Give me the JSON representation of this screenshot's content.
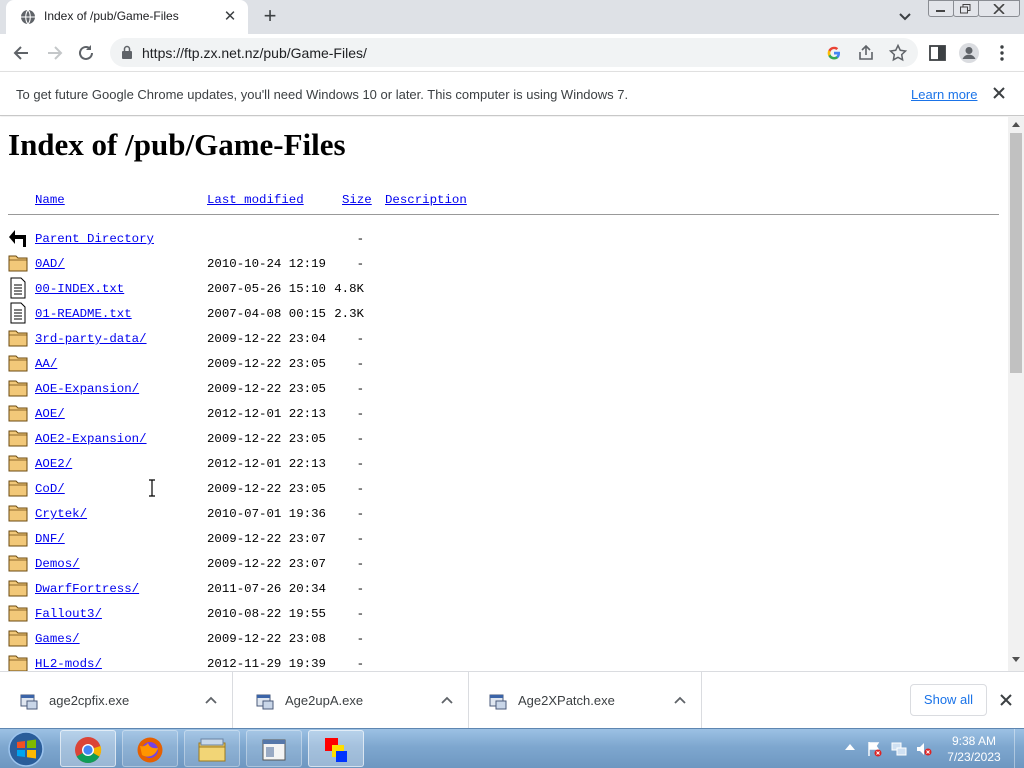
{
  "browser": {
    "tab": {
      "title": "Index of /pub/Game-Files",
      "favicon": "globe-icon"
    },
    "url": "https://ftp.zx.net.nz/pub/Game-Files/",
    "infobar": {
      "message": "To get future Google Chrome updates, you'll need Windows 10 or later. This computer is using Windows 7.",
      "link": "Learn more"
    }
  },
  "page": {
    "heading": "Index of /pub/Game-Files",
    "columns": {
      "name": "Name",
      "modified": "Last modified",
      "size": "Size",
      "description": "Description"
    },
    "rows": [
      {
        "icon": "back-icon",
        "name": "Parent Directory",
        "modified": "",
        "size": "-"
      },
      {
        "icon": "folder-icon",
        "name": "0AD/",
        "modified": "2010-10-24 12:19",
        "size": "-"
      },
      {
        "icon": "text-file-icon",
        "name": "00-INDEX.txt",
        "modified": "2007-05-26 15:10",
        "size": "4.8K"
      },
      {
        "icon": "text-file-icon",
        "name": "01-README.txt",
        "modified": "2007-04-08 00:15",
        "size": "2.3K"
      },
      {
        "icon": "folder-icon",
        "name": "3rd-party-data/",
        "modified": "2009-12-22 23:04",
        "size": "-"
      },
      {
        "icon": "folder-icon",
        "name": "AA/",
        "modified": "2009-12-22 23:05",
        "size": "-"
      },
      {
        "icon": "folder-icon",
        "name": "AOE-Expansion/",
        "modified": "2009-12-22 23:05",
        "size": "-"
      },
      {
        "icon": "folder-icon",
        "name": "AOE/",
        "modified": "2012-12-01 22:13",
        "size": "-"
      },
      {
        "icon": "folder-icon",
        "name": "AOE2-Expansion/",
        "modified": "2009-12-22 23:05",
        "size": "-"
      },
      {
        "icon": "folder-icon",
        "name": "AOE2/",
        "modified": "2012-12-01 22:13",
        "size": "-"
      },
      {
        "icon": "folder-icon",
        "name": "CoD/",
        "modified": "2009-12-22 23:05",
        "size": "-"
      },
      {
        "icon": "folder-icon",
        "name": "Crytek/",
        "modified": "2010-07-01 19:36",
        "size": "-"
      },
      {
        "icon": "folder-icon",
        "name": "DNF/",
        "modified": "2009-12-22 23:07",
        "size": "-"
      },
      {
        "icon": "folder-icon",
        "name": "Demos/",
        "modified": "2009-12-22 23:07",
        "size": "-"
      },
      {
        "icon": "folder-icon",
        "name": "DwarfFortress/",
        "modified": "2011-07-26 20:34",
        "size": "-"
      },
      {
        "icon": "folder-icon",
        "name": "Fallout3/",
        "modified": "2010-08-22 19:55",
        "size": "-"
      },
      {
        "icon": "folder-icon",
        "name": "Games/",
        "modified": "2009-12-22 23:08",
        "size": "-"
      },
      {
        "icon": "folder-icon",
        "name": "HL2-mods/",
        "modified": "2012-11-29 19:39",
        "size": "-"
      }
    ]
  },
  "downloads": {
    "items": [
      {
        "name": "age2cpfix.exe",
        "icon": "exe-icon"
      },
      {
        "name": "Age2upA.exe",
        "icon": "exe-icon"
      },
      {
        "name": "Age2XPatch.exe",
        "icon": "exe-icon"
      }
    ],
    "show_all": "Show all"
  },
  "taskbar": {
    "apps": [
      "chrome-icon",
      "firefox-icon",
      "file-explorer-icon",
      "window-app-icon",
      "paint-app-icon"
    ],
    "time": "9:38 AM",
    "date": "7/23/2023"
  },
  "colors": {
    "link": "#0000ee",
    "accent": "#1a73e8",
    "taskbar": "#7ea7cf"
  }
}
